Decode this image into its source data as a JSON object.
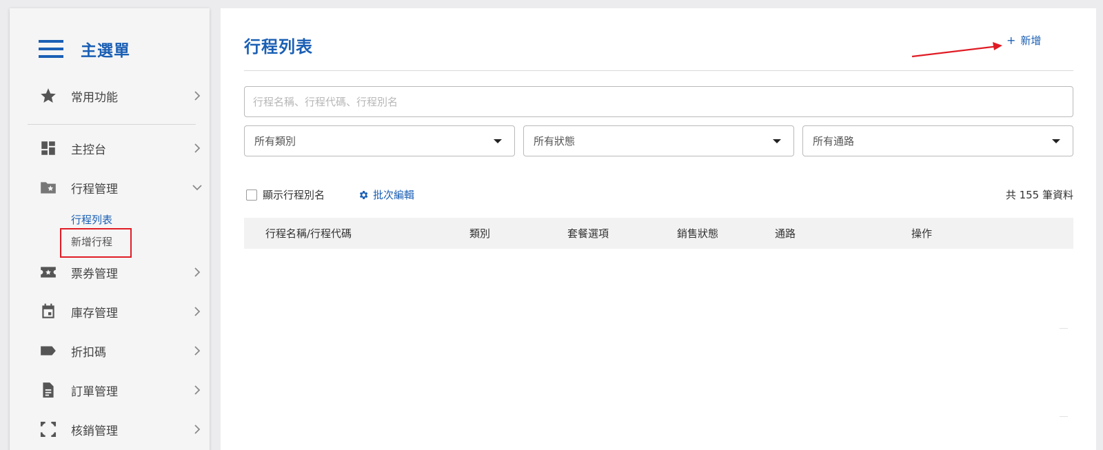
{
  "sidebar": {
    "title": "主選單",
    "items": [
      {
        "label": "常用功能",
        "icon": "star-icon"
      },
      {
        "label": "主控台",
        "icon": "dashboard-icon"
      },
      {
        "label": "行程管理",
        "icon": "folder-star-icon",
        "expanded": true,
        "children": [
          {
            "label": "行程列表",
            "active": true
          },
          {
            "label": "新增行程"
          }
        ]
      },
      {
        "label": "票券管理",
        "icon": "ticket-icon"
      },
      {
        "label": "庫存管理",
        "icon": "calendar-icon"
      },
      {
        "label": "折扣碼",
        "icon": "label-icon"
      },
      {
        "label": "訂單管理",
        "icon": "document-icon"
      },
      {
        "label": "核銷管理",
        "icon": "scan-frame-icon"
      }
    ]
  },
  "main": {
    "title": "行程列表",
    "add_button_label": "新增",
    "add_button_icon": "plus-icon",
    "search_placeholder": "行程名稱、行程代碼、行程別名",
    "filters": [
      {
        "value": "所有類別"
      },
      {
        "value": "所有狀態"
      },
      {
        "value": "所有通路"
      }
    ],
    "show_alias_label": "顯示行程別名",
    "show_alias_checked": false,
    "batch_edit_label": "批次編輯",
    "total_count_label": "共 155 筆資料",
    "table": {
      "columns": [
        "行程名稱/行程代碼",
        "類別",
        "套餐選項",
        "銷售狀態",
        "通路",
        "操作"
      ],
      "rows": []
    }
  },
  "colors": {
    "accent": "#1a5fb4",
    "annotation": "#e01b24",
    "background": "#ececee"
  }
}
